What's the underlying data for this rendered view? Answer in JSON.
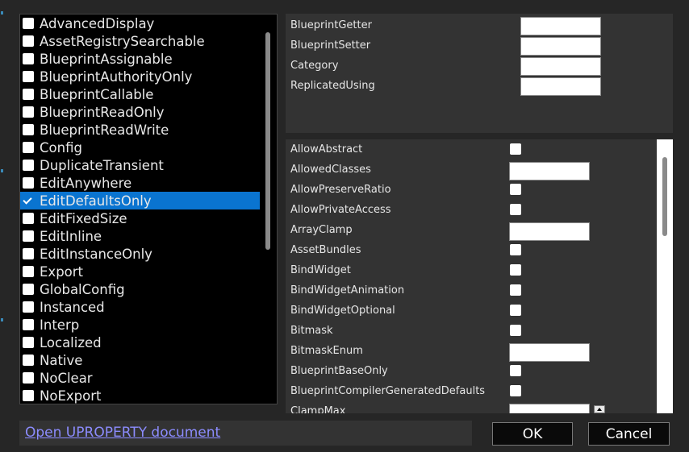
{
  "specifiers": [
    {
      "label": "AdvancedDisplay",
      "checked": false
    },
    {
      "label": "AssetRegistrySearchable",
      "checked": false
    },
    {
      "label": "BlueprintAssignable",
      "checked": false
    },
    {
      "label": "BlueprintAuthorityOnly",
      "checked": false
    },
    {
      "label": "BlueprintCallable",
      "checked": false
    },
    {
      "label": "BlueprintReadOnly",
      "checked": false
    },
    {
      "label": "BlueprintReadWrite",
      "checked": false
    },
    {
      "label": "Config",
      "checked": false
    },
    {
      "label": "DuplicateTransient",
      "checked": false
    },
    {
      "label": "EditAnywhere",
      "checked": false
    },
    {
      "label": "EditDefaultsOnly",
      "checked": true,
      "selected": true
    },
    {
      "label": "EditFixedSize",
      "checked": false
    },
    {
      "label": "EditInline",
      "checked": false
    },
    {
      "label": "EditInstanceOnly",
      "checked": false
    },
    {
      "label": "Export",
      "checked": false
    },
    {
      "label": "GlobalConfig",
      "checked": false
    },
    {
      "label": "Instanced",
      "checked": false
    },
    {
      "label": "Interp",
      "checked": false
    },
    {
      "label": "Localized",
      "checked": false
    },
    {
      "label": "Native",
      "checked": false
    },
    {
      "label": "NoClear",
      "checked": false
    },
    {
      "label": "NoExport",
      "checked": false
    }
  ],
  "text_params": [
    {
      "label": "BlueprintGetter",
      "value": ""
    },
    {
      "label": "BlueprintSetter",
      "value": ""
    },
    {
      "label": "Category",
      "value": ""
    },
    {
      "label": "ReplicatedUsing",
      "value": ""
    }
  ],
  "meta_specifiers": [
    {
      "label": "AllowAbstract",
      "kind": "check",
      "value": false
    },
    {
      "label": "AllowedClasses",
      "kind": "text",
      "value": ""
    },
    {
      "label": "AllowPreserveRatio",
      "kind": "check",
      "value": false
    },
    {
      "label": "AllowPrivateAccess",
      "kind": "check",
      "value": false
    },
    {
      "label": "ArrayClamp",
      "kind": "text",
      "value": ""
    },
    {
      "label": "AssetBundles",
      "kind": "check",
      "value": false
    },
    {
      "label": "BindWidget",
      "kind": "check",
      "value": false
    },
    {
      "label": "BindWidgetAnimation",
      "kind": "check",
      "value": false
    },
    {
      "label": "BindWidgetOptional",
      "kind": "check",
      "value": false
    },
    {
      "label": "Bitmask",
      "kind": "check",
      "value": false
    },
    {
      "label": "BitmaskEnum",
      "kind": "text",
      "value": ""
    },
    {
      "label": "BlueprintBaseOnly",
      "kind": "check",
      "value": false
    },
    {
      "label": "BlueprintCompilerGeneratedDefaults",
      "kind": "check",
      "value": false
    },
    {
      "label": "ClampMax",
      "kind": "spin",
      "value": ""
    }
  ],
  "footer": {
    "doc_link": "Open UPROPERTY document",
    "ok_label": "OK",
    "cancel_label": "Cancel"
  },
  "colors": {
    "background": "#262626",
    "panel": "#333333",
    "list_background": "#000000",
    "selection": "#0a74d0",
    "link": "#8c8cff"
  },
  "icons": {
    "check": "checkmark-icon",
    "spin_up": "spin-up-arrow-icon"
  }
}
